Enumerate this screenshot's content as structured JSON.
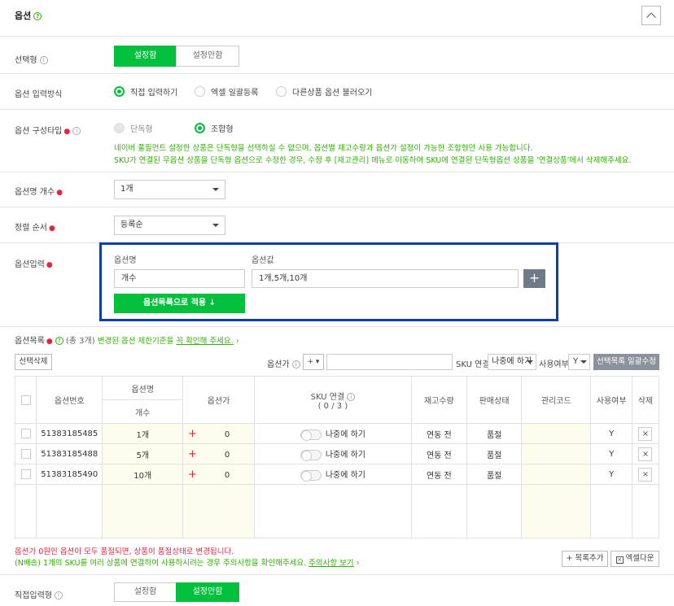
{
  "header": {
    "title": "옵션",
    "help": "?",
    "collapse_icon": "chevron-up"
  },
  "select_type": {
    "label": "선택형",
    "on": "설정함",
    "off": "설정안함"
  },
  "input_method": {
    "label": "옵션 입력방식",
    "options": [
      "직접 입력하기",
      "엑셀 일괄등록",
      "다른상품 옵션 불러오기"
    ]
  },
  "compose_type": {
    "label": "옵션 구성타입",
    "options": [
      "단독형",
      "조합형"
    ],
    "notice1": "네이버 풀필먼트 설정한 상품은 단독형을 선택하실 수 없으며, 옵션별 재고수량과 옵션가 설정이 가능한 조합형만 사용 가능합니다.",
    "notice2": "SKU가 연결된 무옵션 상품을 단독형 옵션으로 수정한 경우, 수정 후 [재고관리] 메뉴로 이동하여 SKU에 연결된 단독형옵션 상품을 '연결상품'에서 삭제해주세요."
  },
  "option_count": {
    "label": "옵션명 개수",
    "value": "1개"
  },
  "sort_order": {
    "label": "정렬 순서",
    "value": "등록순"
  },
  "option_input": {
    "label": "옵션입력",
    "name_header": "옵션명",
    "value_header": "옵션값",
    "name_value": "개수",
    "values_value": "1개,5개,10개",
    "apply_button": "옵션목록으로 적용 ↓",
    "add_icon": "+"
  },
  "option_list": {
    "label": "옵션목록",
    "count": "(총 3개)",
    "notice": "변경된 옵션 제한기준을",
    "link": "꼭 확인해 주세요.",
    "arrow": "›"
  },
  "toolbar": {
    "delete_selected": "선택삭제",
    "price_label": "옵션가",
    "price_sign": "+ ▾",
    "sku_label": "SKU 연결",
    "sku_value": "나중에 하기",
    "usage_label": "사용여부",
    "usage_value": "Y",
    "bulk_edit": "선택목록 일괄수정"
  },
  "table": {
    "headers": {
      "code": "옵션번호",
      "optname": "옵션명",
      "optsub": "개수",
      "price": "옵션가",
      "sku": "SKU 연결",
      "sku_sub": "( 0 / 3 )",
      "stock": "재고수량",
      "status": "판매상태",
      "mgmt": "관리코드",
      "usage": "사용여부",
      "del": "삭제"
    },
    "rows": [
      {
        "code": "51383185485",
        "name": "1개",
        "price": "0",
        "sku": "나중에 하기",
        "stock": "연동 전",
        "status": "품절",
        "usage": "Y"
      },
      {
        "code": "51383185488",
        "name": "5개",
        "price": "0",
        "sku": "나중에 하기",
        "stock": "연동 전",
        "status": "품절",
        "usage": "Y"
      },
      {
        "code": "51383185490",
        "name": "10개",
        "price": "0",
        "sku": "나중에 하기",
        "stock": "연동 전",
        "status": "품절",
        "usage": "Y"
      }
    ]
  },
  "footer": {
    "warn": "옵션가 0원인 옵션이 모두 품절되면, 상품이 품절상태로 변경됩니다.",
    "info": "(N배송) 1개의 SKU를 여러 상품에 연결하여 사용하시려는 경우 주의사항을 확인해주세요.",
    "info_link": "주의사항 보기",
    "add_list": "+ 목록추가",
    "excel_down": "엑셀다운"
  },
  "direct_input": {
    "label": "직접입력형",
    "on": "설정함",
    "off": "설정안함"
  },
  "colors": {
    "accent": "#03c03c",
    "highlight_border": "#0a3ea8",
    "required": "#e8233d"
  }
}
